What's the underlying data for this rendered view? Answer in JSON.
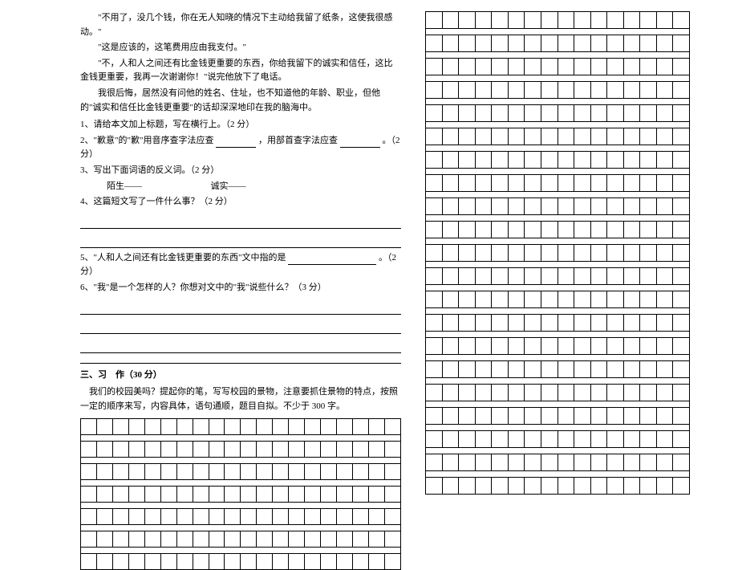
{
  "passage": {
    "p1": "\"不用了，没几个钱，你在无人知晓的情况下主动给我留了纸条，这使我很感动。\"",
    "p2": "\"这是应该的，这笔费用应由我支付。\"",
    "p3": "\"不，人和人之间还有比金钱更重要的东西，你给我留下的诚实和信任，这比金钱更重要，我再一次谢谢你！\"说完他放下了电话。",
    "p4": "我很后悔，居然没有问他的姓名、住址，也不知道他的年龄、职业，但他的\"诚实和信任比金钱更重要\"的话却深深地印在我的脑海中。"
  },
  "questions": {
    "q1": "1、请给本文加上标题，写在横行上。（2 分）",
    "q2_a": "2、\"歉意\"的\"歉\"用音序查字法应查",
    "q2_b": "，用部首查字法应查",
    "q2_c": "。（2 分）",
    "q3": "3、写出下面词语的反义词。（2 分）",
    "q3_word1": "陌生——",
    "q3_word2": "诚实——",
    "q4": "4、这篇短文写了一件什么事？（2 分）",
    "q5_a": "5、\"人和人之间还有比金钱更重要的东西\"文中指的是",
    "q5_b": "。（2 分）",
    "q6": "6、\"我\"是一个怎样的人？你想对文中的\"我\"说些什么？（3 分）"
  },
  "section3": {
    "header": "三、习　作（30 分）",
    "instructions": "我们的校园美吗？提起你的笔，写写校园的景物，注意要抓住景物的特点，按照一定的顺序来写，内容具体，语句通顺，题目自拟。不少于 300 字。"
  }
}
